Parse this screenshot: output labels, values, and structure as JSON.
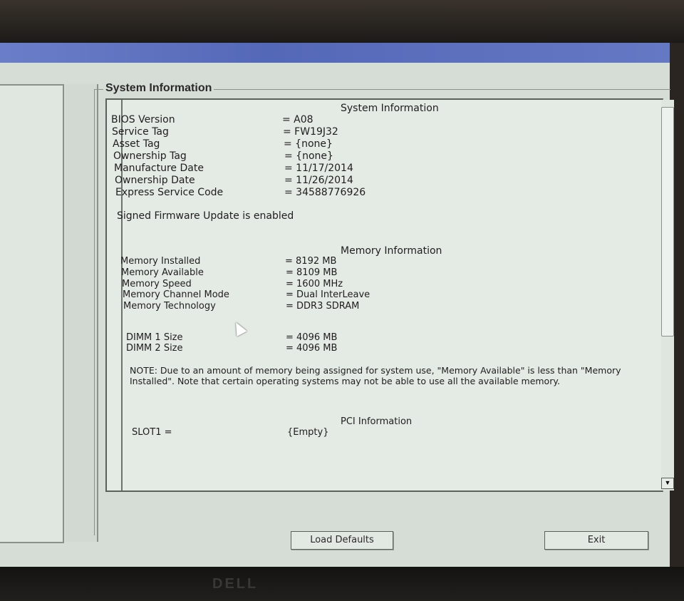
{
  "window": {
    "group_title": "System Information"
  },
  "system_info": {
    "heading": "System Information",
    "rows": [
      {
        "label": "BIOS Version",
        "value": "= A08"
      },
      {
        "label": "Service Tag",
        "value": "= FW19J32"
      },
      {
        "label": "Asset Tag",
        "value": "= {none}"
      },
      {
        "label": "Ownership Tag",
        "value": "= {none}"
      },
      {
        "label": "Manufacture Date",
        "value": "= 11/17/2014"
      },
      {
        "label": "Ownership Date",
        "value": "= 11/26/2014"
      },
      {
        "label": "Express Service Code",
        "value": "= 34588776926"
      }
    ],
    "firmware_note": "Signed Firmware Update is enabled"
  },
  "memory_info": {
    "heading": "Memory Information",
    "rows": [
      {
        "label": "Memory Installed",
        "value": "= 8192 MB"
      },
      {
        "label": "Memory Available",
        "value": "= 8109 MB"
      },
      {
        "label": "Memory Speed",
        "value": "= 1600 MHz"
      },
      {
        "label": "Memory Channel Mode",
        "value": "= Dual InterLeave"
      },
      {
        "label": "Memory Technology",
        "value": "= DDR3 SDRAM"
      }
    ],
    "dimms": [
      {
        "label": "DIMM 1 Size",
        "value": "= 4096 MB"
      },
      {
        "label": "DIMM 2 Size",
        "value": "= 4096 MB"
      }
    ],
    "note": "NOTE: Due to an amount of memory being assigned for system use, \"Memory Available\" is less than \"Memory Installed\". Note that certain operating systems may not be able to use all the available memory."
  },
  "pci_info": {
    "heading": "PCI Information",
    "slot_label": "SLOT1 =",
    "slot_value": "{Empty}"
  },
  "buttons": {
    "load_defaults": "Load Defaults",
    "exit": "Exit"
  },
  "monitor": {
    "brand": "DELL"
  }
}
